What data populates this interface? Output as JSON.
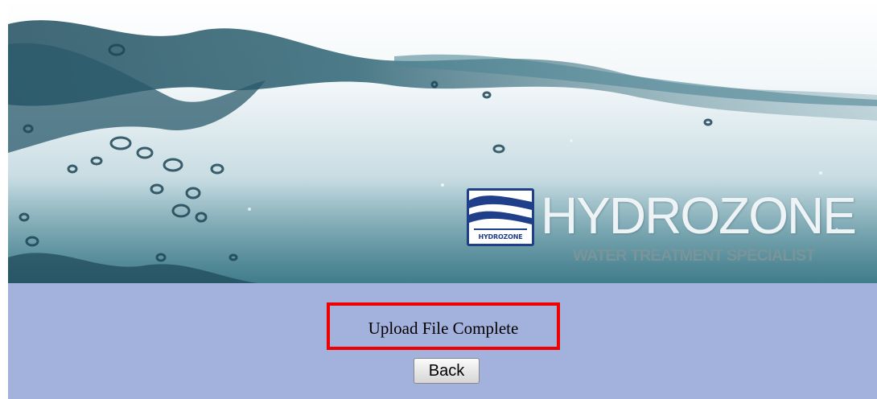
{
  "banner": {
    "brand_name": "HYDROZONE",
    "tagline": "WATER TREATMENT SPECIALIST",
    "badge_text": "HYDROZONE",
    "colors": {
      "badge_border": "#1f3f8a",
      "water_dark": "#2f6474",
      "water_light": "#4d8794"
    }
  },
  "status": {
    "message": "Upload File Complete",
    "highlight_color": "#ee0000"
  },
  "actions": {
    "back_label": "Back"
  },
  "page": {
    "background_color": "#a3b1dd"
  }
}
